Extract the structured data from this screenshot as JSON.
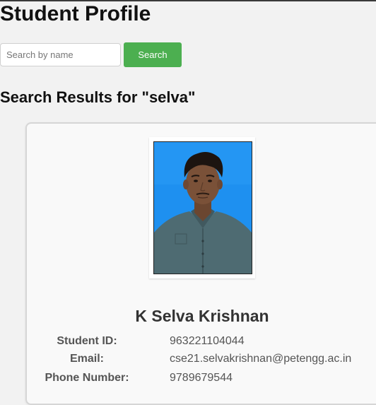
{
  "page": {
    "title": "Student Profile"
  },
  "search": {
    "placeholder": "Search by name",
    "value": "",
    "button_label": "Search"
  },
  "results": {
    "heading": "Search Results for \"selva\""
  },
  "student": {
    "name": "K Selva Krishnan",
    "details": [
      {
        "label": "Student ID:",
        "value": "963221104044"
      },
      {
        "label": "Email:",
        "value": "cse21.selvakrishnan@petengg.ac.in"
      },
      {
        "label": "Phone Number:",
        "value": "9789679544"
      }
    ]
  },
  "colors": {
    "button_green": "#4caf50",
    "photo_background_blue": "#1e90f0"
  }
}
